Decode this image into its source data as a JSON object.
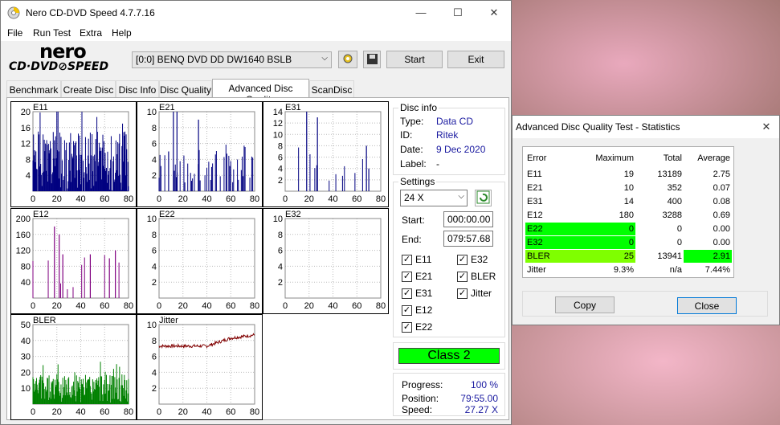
{
  "app_title": "Nero CD-DVD Speed 4.7.7.16",
  "window_buttons": {
    "minimize": "—",
    "maximize": "☐",
    "close": "✕"
  },
  "menu": [
    "File",
    "Run Test",
    "Extra",
    "Help"
  ],
  "logo": {
    "top": "nero",
    "bottom": "CD·DVD⊘SPEED"
  },
  "drive": "[0:0]  BENQ DVD DD DW1640 BSLB",
  "toolbar": {
    "start": "Start",
    "exit": "Exit"
  },
  "tabs": [
    "Benchmark",
    "Create Disc",
    "Disc Info",
    "Disc Quality",
    "Advanced Disc Quality",
    "ScanDisc"
  ],
  "active_tab": 4,
  "charts": [
    {
      "name": "E11",
      "yticks": [
        20,
        16,
        12,
        8,
        4
      ],
      "ymax": 20,
      "color": "#000080",
      "type": "bars",
      "seed": 1,
      "base": 7,
      "var": 8,
      "spikes": [
        [
          75,
          17
        ],
        [
          77,
          15
        ]
      ]
    },
    {
      "name": "E21",
      "yticks": [
        10,
        8,
        6,
        4,
        2
      ],
      "ymax": 10,
      "color": "#000080",
      "type": "spikes",
      "seed": 2,
      "density": 0.45,
      "spikes": [
        [
          12,
          10
        ],
        [
          15,
          10
        ],
        [
          33,
          9
        ],
        [
          8,
          5
        ]
      ]
    },
    {
      "name": "E31",
      "yticks": [
        14,
        12,
        10,
        8,
        6,
        4,
        2
      ],
      "ymax": 14,
      "color": "#000080",
      "type": "spikes",
      "seed": 3,
      "density": 0.12,
      "spikes": [
        [
          18,
          14
        ],
        [
          27,
          13
        ],
        [
          68,
          8
        ],
        [
          70,
          4
        ]
      ]
    },
    {
      "name": "E12",
      "yticks": [
        200,
        160,
        120,
        80,
        40
      ],
      "ymax": 200,
      "color": "#800080",
      "type": "spikes",
      "seed": 4,
      "density": 0.08,
      "spikes": [
        [
          18,
          180
        ],
        [
          22,
          160
        ],
        [
          25,
          110
        ],
        [
          48,
          110
        ],
        [
          64,
          100
        ],
        [
          69,
          120
        ]
      ]
    },
    {
      "name": "E22",
      "yticks": [
        10,
        8,
        6,
        4,
        2
      ],
      "ymax": 10,
      "color": "#000080",
      "type": "empty"
    },
    {
      "name": "E32",
      "yticks": [
        10,
        8,
        6,
        4,
        2
      ],
      "ymax": 10,
      "color": "#000080",
      "type": "empty"
    },
    {
      "name": "BLER",
      "yticks": [
        50,
        40,
        30,
        20,
        10
      ],
      "ymax": 50,
      "color": "#008000",
      "type": "bars",
      "seed": 5,
      "base": 10,
      "var": 9,
      "spikes": [
        [
          21,
          25
        ],
        [
          35,
          20
        ]
      ]
    },
    {
      "name": "Jitter",
      "yticks": [
        10,
        8,
        6,
        4,
        2
      ],
      "ymax": 10,
      "color": "#800000",
      "type": "jitter"
    }
  ],
  "xticks": [
    0,
    20,
    40,
    60,
    80
  ],
  "disc_info": {
    "heading": "Disc info",
    "type_label": "Type:",
    "type": "Data CD",
    "id_label": "ID:",
    "id": "Ritek",
    "date_label": "Date:",
    "date": "9 Dec 2020",
    "label_label": "Label:",
    "label": "-"
  },
  "settings": {
    "heading": "Settings",
    "speed": "24 X",
    "start_label": "Start:",
    "start": "000:00.00",
    "end_label": "End:",
    "end": "079:57.68"
  },
  "checks": [
    "E11",
    "E32",
    "E21",
    "BLER",
    "E31",
    "Jitter",
    "E12",
    "E22"
  ],
  "class_label": "Class 2",
  "progress": {
    "progress_label": "Progress:",
    "progress": "100 %",
    "position_label": "Position:",
    "position": "79:55.00",
    "speed_label": "Speed:",
    "speed": "27.27 X"
  },
  "stats": {
    "title": "Advanced Disc Quality Test - Statistics",
    "headers": [
      "Error",
      "Maximum",
      "Total",
      "Average"
    ],
    "rows": [
      [
        "E11",
        "19",
        "13189",
        "2.75"
      ],
      [
        "E21",
        "10",
        "352",
        "0.07"
      ],
      [
        "E31",
        "14",
        "400",
        "0.08"
      ],
      [
        "E12",
        "180",
        "3288",
        "0.69"
      ],
      [
        "E22",
        "0",
        "0",
        "0.00"
      ],
      [
        "E32",
        "0",
        "0",
        "0.00"
      ],
      [
        "BLER",
        "25",
        "13941",
        "2.91"
      ],
      [
        "Jitter",
        "9.3%",
        "n/a",
        "7.44%"
      ]
    ],
    "copy": "Copy",
    "close": "Close",
    "close_x": "✕"
  }
}
